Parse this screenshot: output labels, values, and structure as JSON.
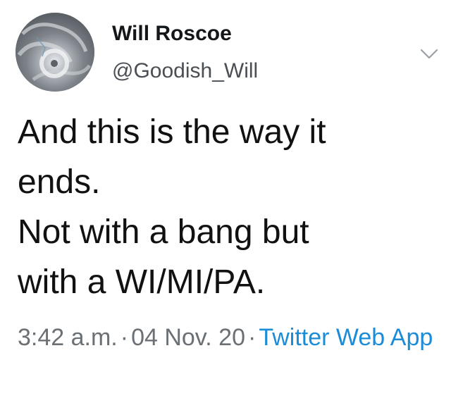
{
  "tweet": {
    "author": {
      "display_name": "Will Roscoe",
      "handle": "@Goodish_Will",
      "avatar_icon": "hurricane-satellite-avatar"
    },
    "menu_icon": "chevron-down-icon",
    "text_lines": [
      "And this is the way it",
      "ends.",
      "Not with a bang but",
      "with a WI/MI/PA."
    ],
    "meta": {
      "time": "3:42 a.m.",
      "separator": "·",
      "date": "04 Nov. 20",
      "source": "Twitter Web App"
    },
    "colors": {
      "link": "#1a8cd8",
      "secondary_text": "#6b7075",
      "primary_text": "#111111"
    }
  }
}
